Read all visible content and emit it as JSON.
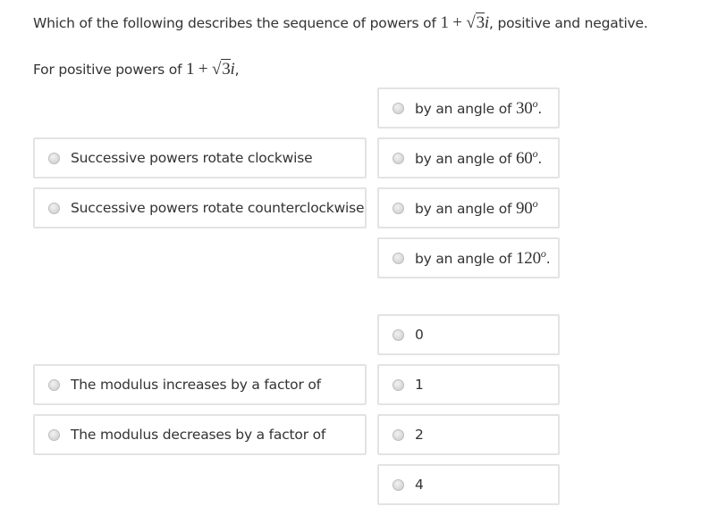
{
  "question": {
    "prefix": "Which of the following describes the sequence of powers of ",
    "expr_one_plus": "1 + ",
    "expr_sqrt_arg": "3",
    "expr_i": "i",
    "suffix": ", positive and negative."
  },
  "subprompt": {
    "prefix": "For positive powers of ",
    "expr_one_plus": "1 + ",
    "expr_sqrt_arg": "3",
    "expr_i": "i",
    "suffix": ","
  },
  "rotation_direction_options": [
    {
      "label": "Successive powers rotate clockwise",
      "selected": false
    },
    {
      "label": "Successive powers rotate counterclockwise",
      "selected": false
    }
  ],
  "angle_options": [
    {
      "prefix": "by an angle of ",
      "value": "30",
      "unit": "o",
      "suffix": "."
    },
    {
      "prefix": "by an angle of ",
      "value": "60",
      "unit": "o",
      "suffix": "."
    },
    {
      "prefix": "by an angle of ",
      "value": "90",
      "unit": "o",
      "suffix": ""
    },
    {
      "prefix": "by an angle of ",
      "value": "120",
      "unit": "o",
      "suffix": "."
    }
  ],
  "modulus_options": [
    {
      "label": "The modulus increases by a factor of",
      "selected": false
    },
    {
      "label": "The modulus decreases by a factor of",
      "selected": false
    }
  ],
  "factor_options": [
    {
      "label": "0",
      "selected": false
    },
    {
      "label": "1",
      "selected": false
    },
    {
      "label": "2",
      "selected": false
    },
    {
      "label": "4",
      "selected": false
    }
  ]
}
